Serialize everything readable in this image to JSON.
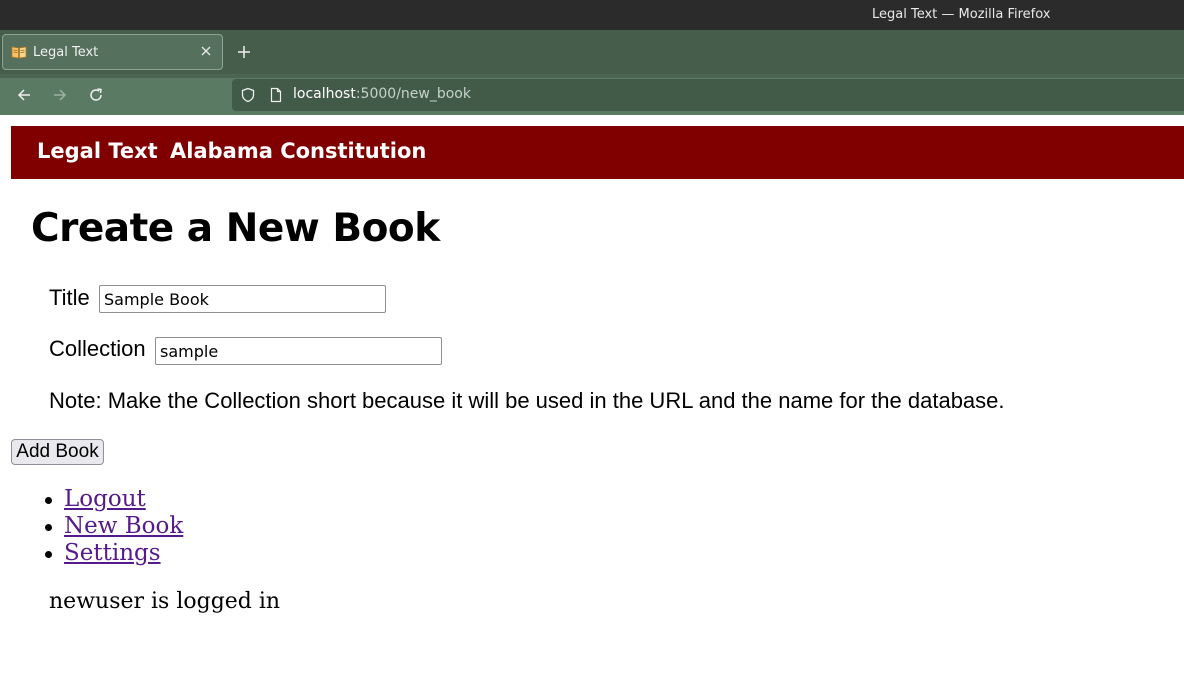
{
  "window": {
    "title": "Legal Text — Mozilla Firefox"
  },
  "tabs": [
    {
      "label": "Legal Text",
      "icon": "book-icon"
    }
  ],
  "address_bar": {
    "host": "localhost",
    "path": ":5000/new_book"
  },
  "site": {
    "brand": "Legal Text",
    "collection": "Alabama Constitution",
    "header_color": "#800000"
  },
  "page": {
    "title": "Create a New Book",
    "form": {
      "title_label": "Title",
      "title_value": "Sample Book",
      "collection_label": "Collection",
      "collection_value": "sample",
      "note": "Note: Make the Collection short because it will be used in the URL and the name for the database.",
      "submit_label": "Add Book"
    },
    "links": [
      {
        "label": "Logout"
      },
      {
        "label": "New Book"
      },
      {
        "label": "Settings"
      }
    ],
    "status": "newuser is logged in"
  },
  "colors": {
    "link": "#551a8b",
    "chrome_green": "#465d4c"
  }
}
